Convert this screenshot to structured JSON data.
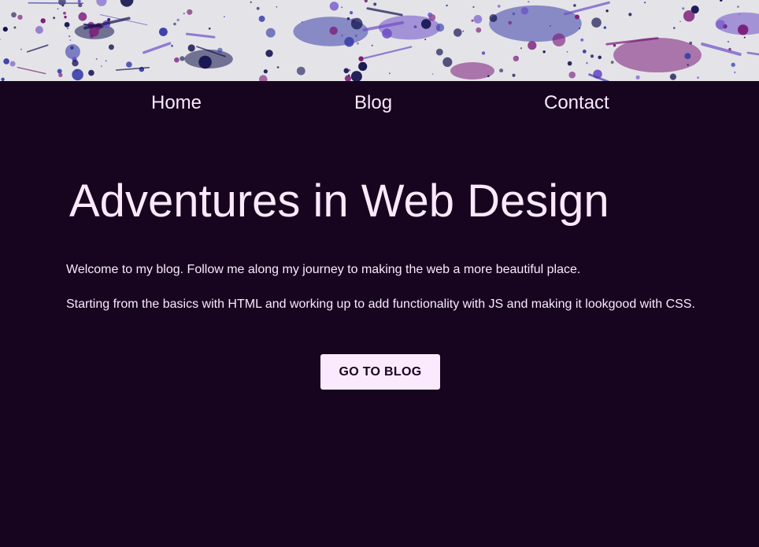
{
  "colors": {
    "background": "#170520",
    "text": "#fbe9fb",
    "button_bg": "#fbeafd",
    "button_text": "#170520",
    "banner_bg": "#e4e4e8",
    "splatter_navy": "#13124f",
    "splatter_blue": "#3a3fa8",
    "splatter_purple": "#7a1a78",
    "splatter_violet": "#6f4fc6"
  },
  "banner": {
    "image": "ink-splatter-banner"
  },
  "nav": {
    "items": [
      {
        "label": "Home"
      },
      {
        "label": "Blog"
      },
      {
        "label": "Contact"
      }
    ]
  },
  "main": {
    "title": "Adventures in Web Design",
    "paragraphs": [
      "Welcome to my blog. Follow me along my journey to making the web a more beautiful place.",
      "Starting from the basics with HTML and working up to add functionality with JS and making it lookgood with CSS."
    ],
    "cta_label": "GO TO BLOG"
  }
}
